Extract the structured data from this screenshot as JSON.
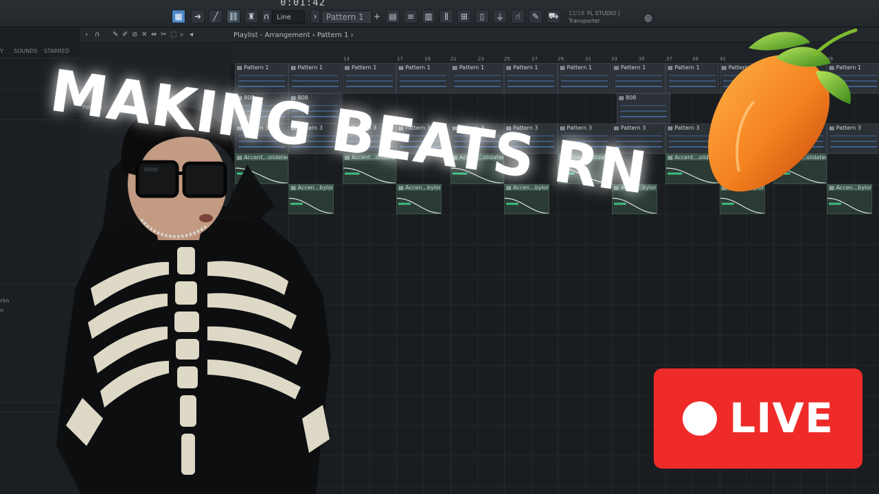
{
  "toolbar": {
    "time": "0:01:42",
    "snap_mode": "Line",
    "pattern": "Pattern 1",
    "plus": "+",
    "hint_counter": "12/18",
    "hint_app": "FL STUDIO |",
    "hint_line2": "Transporter"
  },
  "browser": {
    "tabs": [
      "Y",
      "SOUNDS",
      "STARRED"
    ],
    "items": [
      "rim",
      "n"
    ]
  },
  "playlist": {
    "title": "Playlist - Arrangement",
    "separator": "›",
    "pattern": "Pattern 1",
    "ruler": [
      "13",
      "17",
      "19",
      "21",
      "23",
      "25",
      "27",
      "29",
      "31",
      "33",
      "35",
      "37",
      "39",
      "41",
      "49"
    ],
    "left_labels": [
      "Pattern"
    ],
    "clips": {
      "pattern1": "Pattern 1",
      "b808": "808",
      "pattern3": "Pattern 3",
      "accent_a": "Accent...olidated)",
      "accent_b": "Accen...byloner"
    }
  },
  "overlay": {
    "title": "MAKING BEATS RN",
    "live": "LIVE"
  },
  "colors": {
    "live_red": "#ef2b2a",
    "accent_blue": "#4a86c8",
    "background": "#16191c"
  },
  "icons": [
    "fl-studio-logo",
    "record-icon",
    "link-icon",
    "plug-icon",
    "globe-icon"
  ]
}
